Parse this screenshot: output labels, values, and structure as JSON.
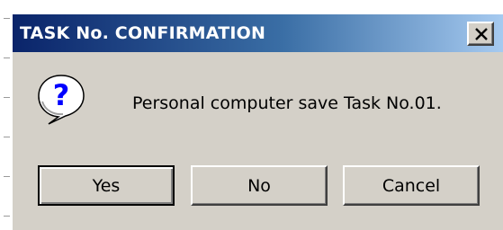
{
  "dialog": {
    "title": "TASK No. CONFIRMATION",
    "message": "Personal computer save Task No.01.",
    "icon": "question-icon",
    "close_icon": "close-icon"
  },
  "buttons": {
    "yes_label": "Yes",
    "no_label": "No",
    "cancel_label": "Cancel"
  },
  "colors": {
    "titlebar_start": "#0a246a",
    "titlebar_end": "#a6caf0",
    "dialog_face": "#d4d0c8"
  }
}
